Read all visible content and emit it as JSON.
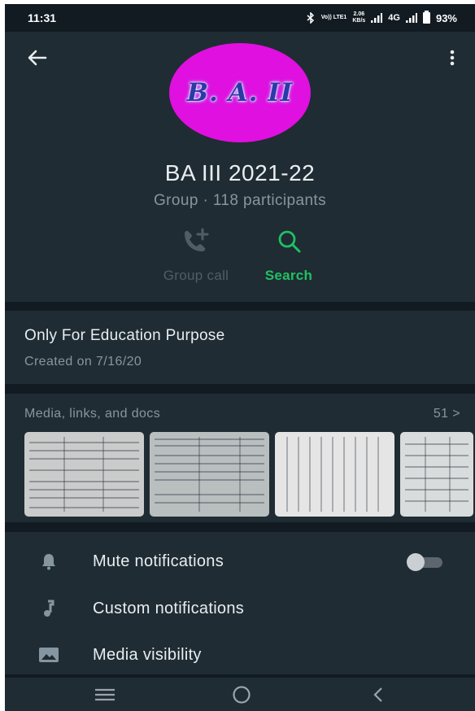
{
  "status_bar": {
    "time": "11:31",
    "signal_info": "Vo)) LTE1",
    "net_speed_value": "2.06",
    "net_speed_unit": "KB/s",
    "network": "4G",
    "battery_level": 93,
    "battery_text": "93%"
  },
  "header": {
    "avatar_text": "B. A. II",
    "group_name": "BA III  2021-22",
    "group_subtitle": "Group · 118 participants",
    "actions": [
      {
        "label": "Group call",
        "icon": "add-call-icon",
        "enabled": false
      },
      {
        "label": "Search",
        "icon": "search-icon",
        "enabled": true
      }
    ]
  },
  "description": {
    "title": "Only For Education Purpose",
    "created": "Created on 7/16/20"
  },
  "media": {
    "heading": "Media, links, and docs",
    "count": "51 >"
  },
  "settings": [
    {
      "label": "Mute notifications",
      "icon": "bell-icon",
      "toggle": false
    },
    {
      "label": "Custom notifications",
      "icon": "music-note-icon"
    },
    {
      "label": "Media visibility",
      "icon": "image-icon"
    }
  ],
  "colors": {
    "background": "#121b22",
    "panel": "#1f2c33",
    "accent": "#21c063",
    "avatar": "#df10e0",
    "muted_text": "#8696a0"
  }
}
